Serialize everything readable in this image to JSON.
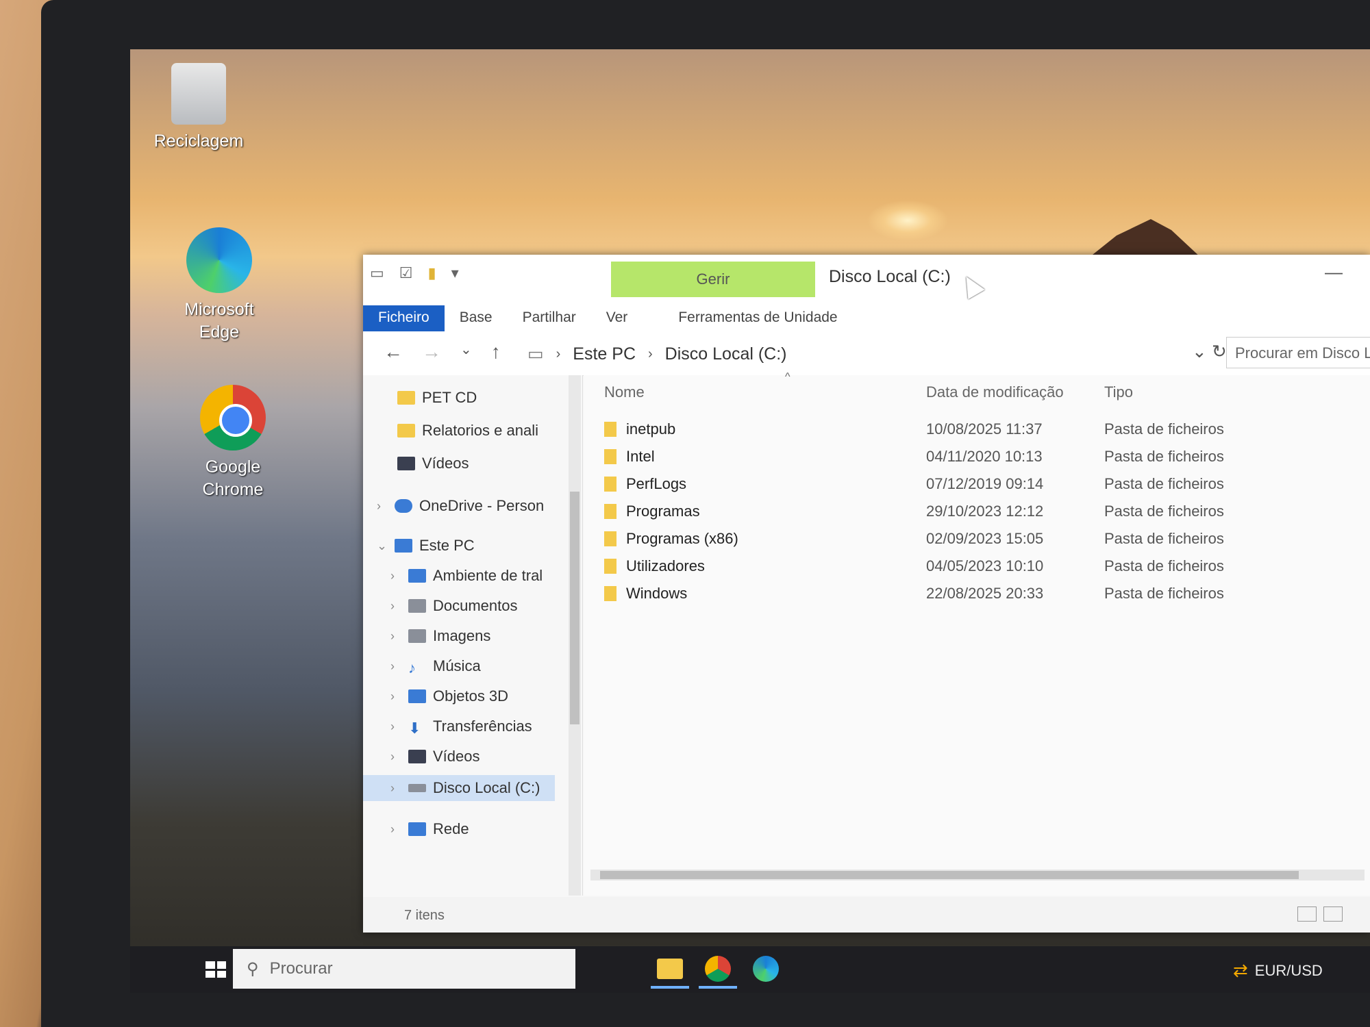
{
  "desktop": {
    "icons": [
      {
        "label": "Reciclagem",
        "icon": "recycle-bin-icon"
      },
      {
        "label": "Microsoft Edge",
        "icon": "edge-icon"
      },
      {
        "label": "Google Chrome",
        "icon": "chrome-icon"
      }
    ]
  },
  "explorer": {
    "title": "Disco Local (C:)",
    "contextual_tab": "Gerir",
    "ribbon_tabs": [
      "Ficheiro",
      "Base",
      "Partilhar",
      "Ver",
      "Ferramentas de Unidade"
    ],
    "active_tab": "Ficheiro",
    "breadcrumb": [
      "Este PC",
      "Disco Local (C:)"
    ],
    "search_placeholder": "Procurar em Disco Local (C:)",
    "nav": [
      {
        "label": "PET CD",
        "icon": "folder-icon",
        "indent": 1
      },
      {
        "label": "Relatorios e anali",
        "icon": "folder-icon",
        "indent": 1
      },
      {
        "label": "Vídeos",
        "icon": "videos-icon",
        "indent": 1
      },
      {
        "label": "OneDrive - Person",
        "icon": "onedrive-icon",
        "indent": 0
      },
      {
        "label": "Este PC",
        "icon": "pc-icon",
        "indent": 0
      },
      {
        "label": "Ambiente de tral",
        "icon": "desktop-icon",
        "indent": 1
      },
      {
        "label": "Documentos",
        "icon": "documents-icon",
        "indent": 1
      },
      {
        "label": "Imagens",
        "icon": "pictures-icon",
        "indent": 1
      },
      {
        "label": "Música",
        "icon": "music-icon",
        "indent": 1
      },
      {
        "label": "Objetos 3D",
        "icon": "3d-objects-icon",
        "indent": 1
      },
      {
        "label": "Transferências",
        "icon": "downloads-icon",
        "indent": 1
      },
      {
        "label": "Vídeos",
        "icon": "videos-icon",
        "indent": 1
      },
      {
        "label": "Disco Local (C:)",
        "icon": "drive-icon",
        "indent": 1,
        "selected": true
      },
      {
        "label": "Rede",
        "icon": "network-icon",
        "indent": 0
      }
    ],
    "columns": {
      "name": "Nome",
      "date": "Data de modificação",
      "type": "Tipo"
    },
    "files": [
      {
        "name": "inetpub",
        "date": "10/08/2025 11:37",
        "type": "Pasta de ficheiros"
      },
      {
        "name": "Intel",
        "date": "04/11/2020 10:13",
        "type": "Pasta de ficheiros"
      },
      {
        "name": "PerfLogs",
        "date": "07/12/2019 09:14",
        "type": "Pasta de ficheiros"
      },
      {
        "name": "Programas",
        "date": "29/10/2023 12:12",
        "type": "Pasta de ficheiros"
      },
      {
        "name": "Programas (x86)",
        "date": "02/09/2023 15:05",
        "type": "Pasta de ficheiros"
      },
      {
        "name": "Utilizadores",
        "date": "04/05/2023 10:10",
        "type": "Pasta de ficheiros"
      },
      {
        "name": "Windows",
        "date": "22/08/2025 20:33",
        "type": "Pasta de ficheiros"
      }
    ],
    "status": "7 itens"
  },
  "taskbar": {
    "search_placeholder": "Procurar",
    "apps": [
      "file-explorer-icon",
      "chrome-icon",
      "edge-icon"
    ],
    "ticker": "EUR/USD"
  },
  "colors": {
    "ribbon_active": "#1b5fc4",
    "gerir_highlight": "#b6e66a",
    "folder": "#f3c94a"
  }
}
